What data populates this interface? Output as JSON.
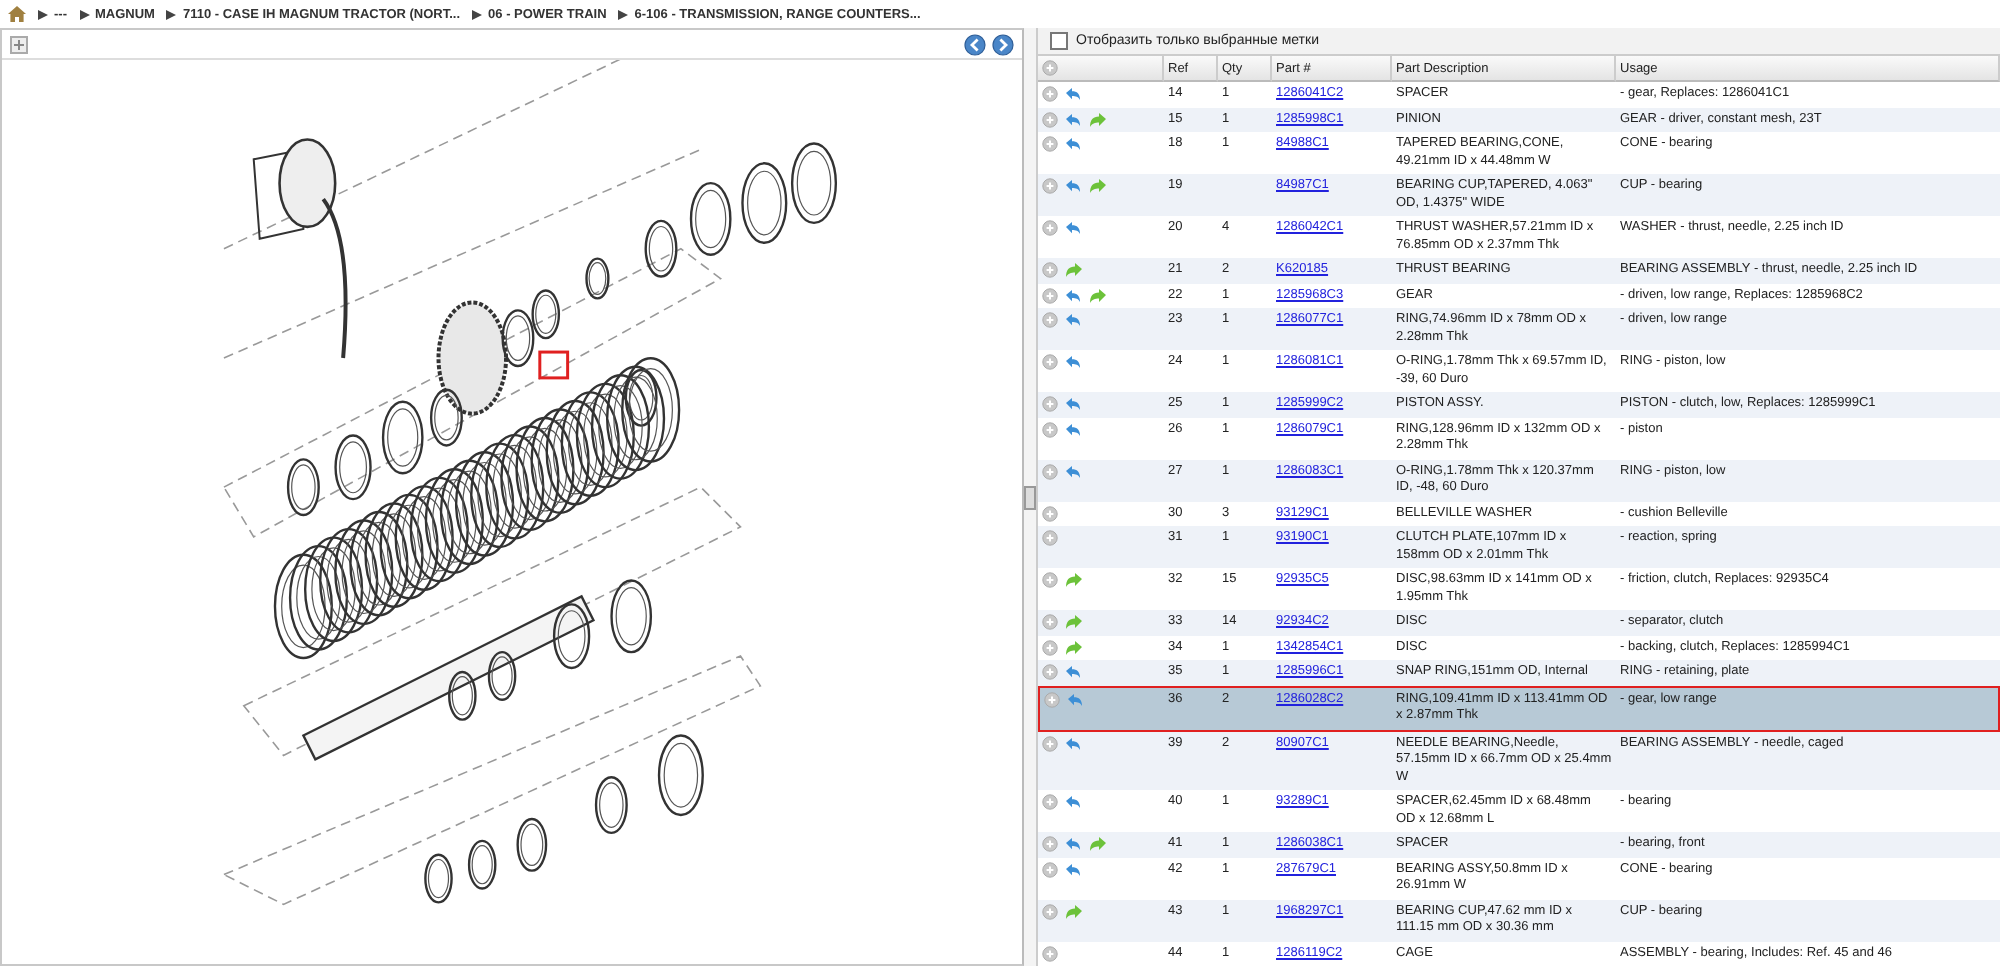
{
  "breadcrumb": [
    {
      "label": "---"
    },
    {
      "label": "MAGNUM"
    },
    {
      "label": "7110 - CASE IH MAGNUM TRACTOR (NORT..."
    },
    {
      "label": "06 - POWER TRAIN"
    },
    {
      "label": "6-106 - TRANSMISSION, RANGE COUNTERS..."
    }
  ],
  "filter": {
    "label": "Отобразить только выбранные метки",
    "checked": false
  },
  "table": {
    "columns": [
      "Ref",
      "Qty",
      "Part #",
      "Part Description",
      "Usage"
    ],
    "rows": [
      {
        "ref": "14",
        "qty": "1",
        "part": "1286041C2",
        "description": "SPACER",
        "usage": "- gear, Replaces: 1286041C1",
        "back": true,
        "forward": false,
        "selected": false
      },
      {
        "ref": "15",
        "qty": "1",
        "part": "1285998C1",
        "description": "PINION",
        "usage": "GEAR - driver, constant mesh, 23T",
        "back": true,
        "forward": true,
        "selected": false
      },
      {
        "ref": "18",
        "qty": "1",
        "part": "84988C1",
        "description": "TAPERED BEARING,CONE, 49.21mm ID x 44.48mm W",
        "usage": "CONE - bearing",
        "back": true,
        "forward": false,
        "selected": false
      },
      {
        "ref": "19",
        "part": "84987C1",
        "description": "BEARING CUP,TAPERED, 4.063\" OD, 1.4375\" WIDE",
        "usage": "CUP - bearing",
        "back": true,
        "forward": true,
        "selected": false
      },
      {
        "ref": "20",
        "qty": "4",
        "part": "1286042C1",
        "description": "THRUST WASHER,57.21mm ID x 76.85mm OD x 2.37mm Thk",
        "usage": "WASHER - thrust, needle, 2.25 inch ID",
        "back": true,
        "forward": false,
        "selected": false
      },
      {
        "ref": "21",
        "qty": "2",
        "part": "K620185",
        "description": "THRUST BEARING",
        "usage": "BEARING ASSEMBLY - thrust, needle, 2.25 inch ID",
        "back": false,
        "forward": true,
        "selected": false
      },
      {
        "ref": "22",
        "qty": "1",
        "part": "1285968C3",
        "description": "GEAR",
        "usage": "- driven, low range, Replaces: 1285968C2",
        "back": true,
        "forward": true,
        "selected": false
      },
      {
        "ref": "23",
        "qty": "1",
        "part": "1286077C1",
        "description": "RING,74.96mm ID x 78mm OD x 2.28mm Thk",
        "usage": "- driven, low range",
        "back": true,
        "forward": false,
        "selected": false
      },
      {
        "ref": "24",
        "qty": "1",
        "part": "1286081C1",
        "description": "O-RING,1.78mm Thk x 69.57mm ID, -39, 60 Duro",
        "usage": "RING - piston, low",
        "back": true,
        "forward": false,
        "selected": false
      },
      {
        "ref": "25",
        "qty": "1",
        "part": "1285999C2",
        "description": "PISTON ASSY.",
        "usage": "PISTON - clutch, low, Replaces: 1285999C1",
        "back": true,
        "forward": false,
        "selected": false
      },
      {
        "ref": "26",
        "qty": "1",
        "part": "1286079C1",
        "description": "RING,128.96mm ID x 132mm OD x 2.28mm Thk",
        "usage": "- piston",
        "back": true,
        "forward": false,
        "selected": false
      },
      {
        "ref": "27",
        "qty": "1",
        "part": "1286083C1",
        "description": "O-RING,1.78mm Thk x 120.37mm ID, -48, 60 Duro",
        "usage": "RING - piston, low",
        "back": true,
        "forward": false,
        "selected": false
      },
      {
        "ref": "30",
        "qty": "3",
        "part": "93129C1",
        "description": "BELLEVILLE WASHER",
        "usage": "- cushion Belleville",
        "back": false,
        "forward": false,
        "selected": false
      },
      {
        "ref": "31",
        "qty": "1",
        "part": "93190C1",
        "description": "CLUTCH PLATE,107mm ID x 158mm OD x 2.01mm Thk",
        "usage": "- reaction, spring",
        "back": false,
        "forward": false,
        "selected": false
      },
      {
        "ref": "32",
        "qty": "15",
        "part": "92935C5",
        "description": "DISC,98.63mm ID x 141mm OD x 1.95mm Thk",
        "usage": "- friction, clutch, Replaces: 92935C4",
        "back": false,
        "forward": true,
        "selected": false
      },
      {
        "ref": "33",
        "qty": "14",
        "part": "92934C2",
        "description": "DISC",
        "usage": "- separator, clutch",
        "back": false,
        "forward": true,
        "selected": false
      },
      {
        "ref": "34",
        "qty": "1",
        "part": "1342854C1",
        "description": "DISC",
        "usage": "- backing, clutch, Replaces: 1285994C1",
        "back": false,
        "forward": true,
        "selected": false
      },
      {
        "ref": "35",
        "qty": "1",
        "part": "1285996C1",
        "description": "SNAP RING,151mm OD, Internal",
        "usage": "RING - retaining, plate",
        "back": true,
        "forward": false,
        "selected": false
      },
      {
        "ref": "36",
        "qty": "2",
        "part": "1286028C2",
        "description": "RING,109.41mm ID x 113.41mm OD x 2.87mm Thk",
        "usage": "- gear, low range",
        "back": true,
        "forward": false,
        "selected": true
      },
      {
        "ref": "39",
        "qty": "2",
        "part": "80907C1",
        "description": "NEEDLE BEARING,Needle, 57.15mm ID x 66.7mm OD x 25.4mm W",
        "usage": "BEARING ASSEMBLY - needle, caged",
        "back": true,
        "forward": false,
        "selected": false
      },
      {
        "ref": "40",
        "qty": "1",
        "part": "93289C1",
        "description": "SPACER,62.45mm ID x 68.48mm OD x 12.68mm L",
        "usage": "- bearing",
        "back": true,
        "forward": false,
        "selected": false
      },
      {
        "ref": "41",
        "qty": "1",
        "part": "1286038C1",
        "description": "SPACER",
        "usage": "- bearing, front",
        "back": true,
        "forward": true,
        "selected": false
      },
      {
        "ref": "42",
        "qty": "1",
        "part": "287679C1",
        "description": "BEARING ASSY,50.8mm ID x 26.91mm W",
        "usage": "CONE - bearing",
        "back": true,
        "forward": false,
        "selected": false
      },
      {
        "ref": "43",
        "qty": "1",
        "part": "1968297C1",
        "description": "BEARING CUP,47.62 mm ID x 111.15 mm OD x 30.36 mm",
        "usage": "CUP - bearing",
        "back": false,
        "forward": true,
        "selected": false
      },
      {
        "ref": "44",
        "qty": "1",
        "part": "1286119C2",
        "description": "CAGE",
        "usage": "ASSEMBLY - bearing, Includes: Ref. 45 and 46",
        "back": false,
        "forward": false,
        "selected": false
      }
    ]
  }
}
